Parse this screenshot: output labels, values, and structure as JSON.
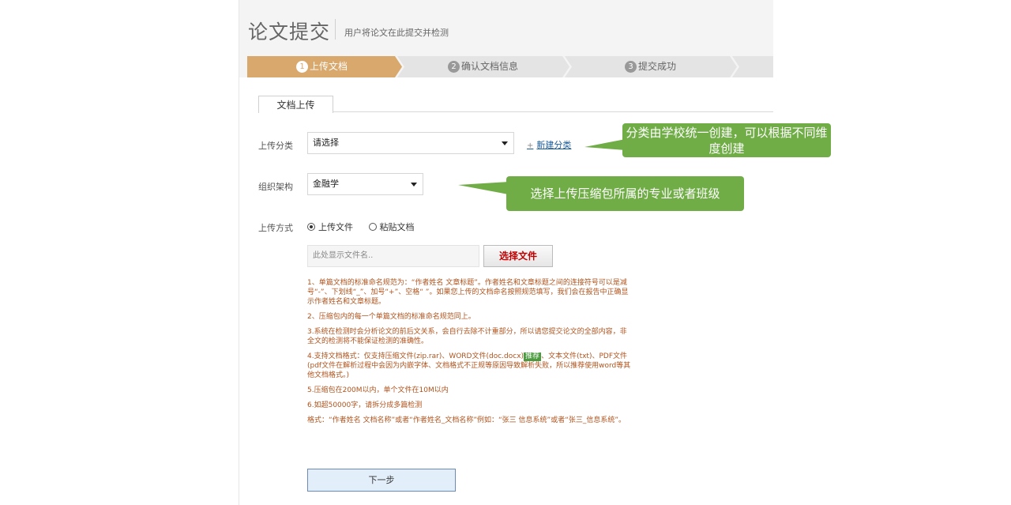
{
  "header": {
    "title": "论文提交",
    "subtitle": "用户将论文在此提交并检测"
  },
  "steps": [
    {
      "num": "1",
      "label": "上传文档",
      "active": true
    },
    {
      "num": "2",
      "label": "确认文档信息",
      "active": false
    },
    {
      "num": "3",
      "label": "提交成功",
      "active": false
    }
  ],
  "tab": {
    "label": "文档上传"
  },
  "form": {
    "category_label": "上传分类",
    "category_value": "请选择",
    "new_category_plus": "+",
    "new_category_link": "新建分类",
    "org_label": "组织架构",
    "org_value": "金融学",
    "method_label": "上传方式",
    "method_options": [
      "上传文件",
      "粘贴文档"
    ],
    "method_selected": "上传文件",
    "file_placeholder": "此处显示文件名..",
    "choose_file_button": "选择文件"
  },
  "notes": [
    "1、单篇文档的标准命名规范为：“作者姓名 文章标题”。作者姓名和文章标题之间的连接符号可以是减号“-”、下划线“_”、加号“+”、空格“ ”。如果您上传的文档命名按照规范填写，我们会在报告中正确显示作者姓名和文章标题。",
    "2、压缩包内的每一个单篇文档的标准命名规范同上。",
    "3.系统在检测时会分析论文的前后文关系，会自行去除不计重部分，所以请您提交论文的全部内容，非全文的检测将不能保证检测的准确性。",
    "6.如超50000字，请拆分成多篇检测",
    "格式：“作者姓名 文档名称”或者“作者姓名_文档名称”例如：“张三 信息系统”或者“张三_信息系统”。"
  ],
  "note4": {
    "before": "4.支持文档格式：仅支持压缩文件(zip.rar)、WORD文件(doc.docx)",
    "badge": "推荐",
    "after": "、文本文件(txt)、PDF文件(pdf文件在解析过程中会因为内嵌字体、文档格式不正规等原因导致解析失败，所以推荐使用word等其他文档格式。)"
  },
  "note5": "5.压缩包在200M以内，单个文件在10M以内",
  "next_button": "下一步",
  "callouts": {
    "category_tip": "分类由学校统一创建，可以根据不同维度创建",
    "org_tip": "选择上传压缩包所属的专业或者班级"
  },
  "colors": {
    "active_step": "#d8a86c",
    "inactive_step": "#e4e4e4",
    "callout": "#70ad47",
    "notes_text": "#b0531c",
    "choose_file_text": "#c00000"
  }
}
